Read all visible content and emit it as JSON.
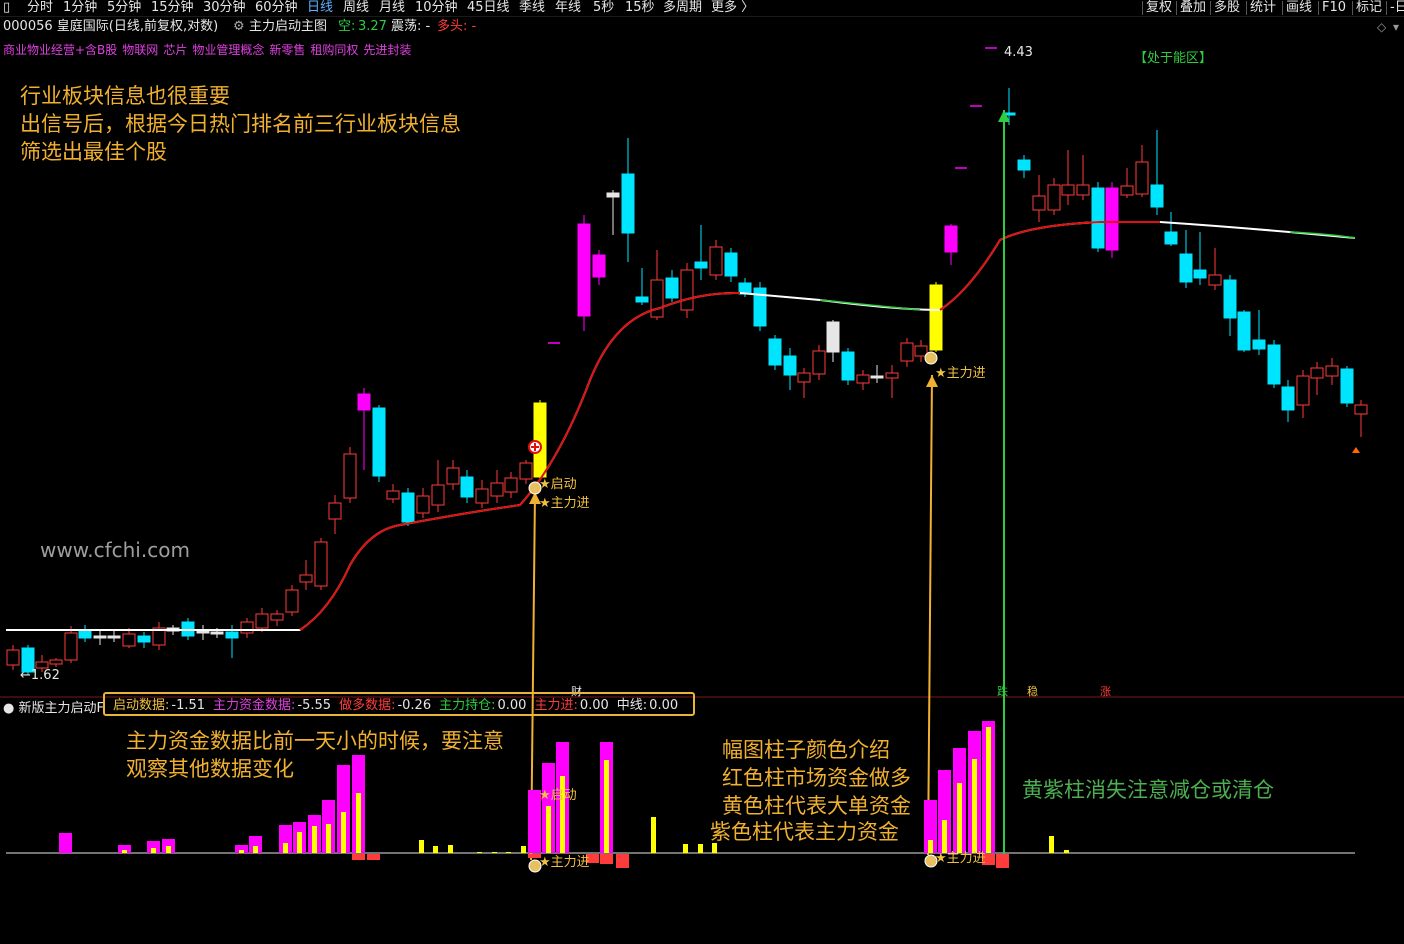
{
  "toolbar": {
    "periods": [
      "分时",
      "1分钟",
      "5分钟",
      "15分钟",
      "30分钟",
      "60分钟",
      "日线",
      "周线",
      "月线",
      "10分钟",
      "45日线",
      "季线",
      "年线",
      "5秒",
      "15秒",
      "多周期",
      "更多 〉"
    ],
    "active_period": "日线",
    "right_tools": [
      "复权",
      "叠加",
      "多股",
      "统计",
      "画线",
      "F10",
      "标记",
      "-日"
    ]
  },
  "title_row": {
    "stock": "000056 皇庭国际(日线,前复权,对数)",
    "indicator_name": "主力启动主图",
    "kong_label": "空:",
    "kong_value": "3.27",
    "zhendang_label": "震荡: -",
    "duotou_label": "多头: -"
  },
  "sector_tags": [
    "商业物业经营+含B股",
    "物联网",
    "芯片",
    "物业管理概念",
    "新零售",
    "租购同权",
    "先进封装"
  ],
  "notes": {
    "industry_1": "行业板块信息也很重要",
    "industry_2": "出信号后，根据今日热门排名前三行业板块信息",
    "industry_3": "筛选出最佳个股",
    "fund_1": "主力资金数据比前一天小的时候，要注意",
    "fund_2": "观察其他数据变化",
    "color_1": "幅图柱子颜色介绍",
    "color_2": "红色柱市场资金做多",
    "color_3": "黄色柱代表大单资金",
    "color_4": "紫色柱代表主力资金",
    "warn": "黄紫柱消失注意减仓或清仓"
  },
  "watermark": "www.cfchi.com",
  "zone_label": "【处于能区】",
  "price_high": "4.43",
  "price_low": "1.62",
  "signals": {
    "start": "★启动",
    "main_in": "★主力进"
  },
  "markers": {
    "cai": "财",
    "die": "跌",
    "wen": "稳",
    "zhang": "涨"
  },
  "indicator": {
    "name": "新版主力启动F",
    "fields": [
      {
        "label": "启动数据:",
        "value": "-1.51",
        "color": "#f0c040"
      },
      {
        "label": "主力资金数据:",
        "value": "-5.55",
        "color": "#e040e0"
      },
      {
        "label": "做多数据:",
        "value": "-0.26",
        "color": "#ff3b3b"
      },
      {
        "label": "主力持仓:",
        "value": "0.00",
        "color": "#2ecc40"
      },
      {
        "label": "主力进:",
        "value": "0.00",
        "color": "#ff3b3b"
      },
      {
        "label": "中线:",
        "value": "0.00",
        "color": "#e6e6e6"
      }
    ]
  },
  "colors": {
    "up": "#ff3b3b",
    "down": "#00e5ff",
    "magenta": "#ff00ff",
    "yellow": "#ffff00",
    "ma_line": "#e01010",
    "orange_arrow": "#f0b030",
    "green_arrow": "#2ecc40"
  }
}
